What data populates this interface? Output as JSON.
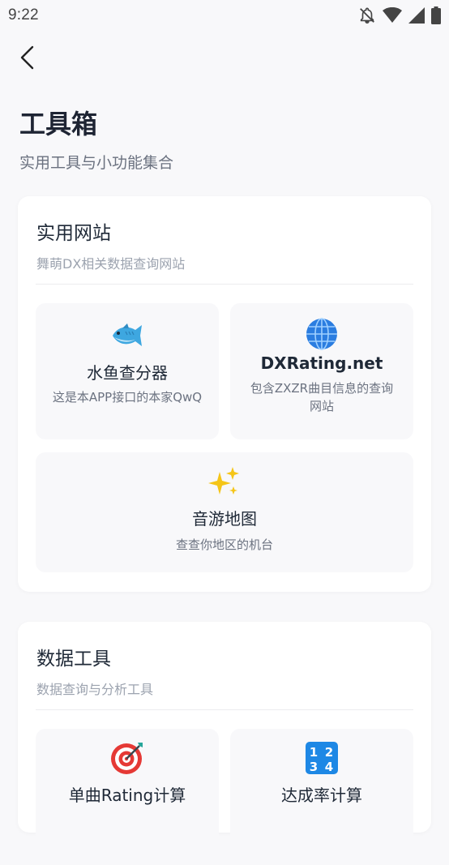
{
  "status_bar": {
    "time": "9:22"
  },
  "header": {
    "title": "工具箱",
    "subtitle": "实用工具与小功能集合"
  },
  "sections": [
    {
      "title": "实用网站",
      "description": "舞萌DX相关数据查询网站",
      "items": [
        {
          "icon": "fish-icon",
          "name": "水鱼查分器",
          "description": "这是本APP接口的本家QwQ"
        },
        {
          "icon": "globe-icon",
          "name": "DXRating.net",
          "description": "包含ZXZR曲目信息的查询网站"
        },
        {
          "icon": "sparkles-icon",
          "name": "音游地图",
          "description": "查查你地区的机台"
        }
      ]
    },
    {
      "title": "数据工具",
      "description": "数据查询与分析工具",
      "items": [
        {
          "icon": "target-icon",
          "name": "单曲Rating计算",
          "description": ""
        },
        {
          "icon": "numbers-icon",
          "name": "达成率计算",
          "description": ""
        }
      ]
    }
  ]
}
